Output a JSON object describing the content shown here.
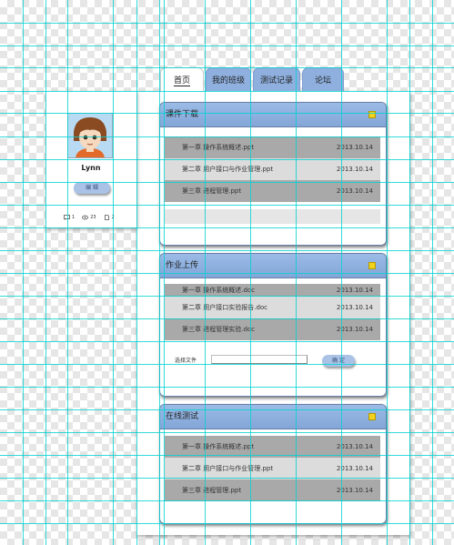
{
  "tabs": [
    {
      "label": "首页",
      "active": true
    },
    {
      "label": "我的班级"
    },
    {
      "label": "测试记录"
    },
    {
      "label": "论坛"
    }
  ],
  "profile": {
    "username": "Lynn",
    "edit_label": "编 辑",
    "stats": [
      {
        "icon": "message-icon",
        "count": "1"
      },
      {
        "icon": "eye-icon",
        "count": "23"
      },
      {
        "icon": "document-icon",
        "count": "2"
      }
    ]
  },
  "sections": {
    "courseware": {
      "title": "课件下载",
      "items": [
        {
          "name": "第一章 操作系统概述.ppt",
          "date": "2013.10.14"
        },
        {
          "name": "第二章 用户接口与作业管理.ppt",
          "date": "2013.10.14"
        },
        {
          "name": "第三章 进程管理.ppt",
          "date": "2013.10.14"
        }
      ]
    },
    "homework": {
      "title": "作业上传",
      "items": [
        {
          "name": "第一章 操作系统概述.doc",
          "date": "2013.10.14"
        },
        {
          "name": "第二章 用户接口实验报告.doc",
          "date": "2013.10.14"
        },
        {
          "name": "第三章 进程管理实验.doc",
          "date": "2013.10.14"
        }
      ],
      "file_label": "选择文件",
      "confirm_label": "确 定"
    },
    "online_test": {
      "title": "在线测试",
      "items": [
        {
          "name": "第一章 操作系统概述.ppt",
          "date": "2013.10.14"
        },
        {
          "name": "第二章 用户接口与作业管理.ppt",
          "date": "2013.10.14"
        },
        {
          "name": "第三章 进程管理.ppt",
          "date": "2013.10.14"
        }
      ]
    }
  },
  "colors": {
    "accent": "#8fb0df",
    "guide": "#00d2d2",
    "row_dark": "#a9a9a9",
    "row_light": "#dcdcdc"
  }
}
